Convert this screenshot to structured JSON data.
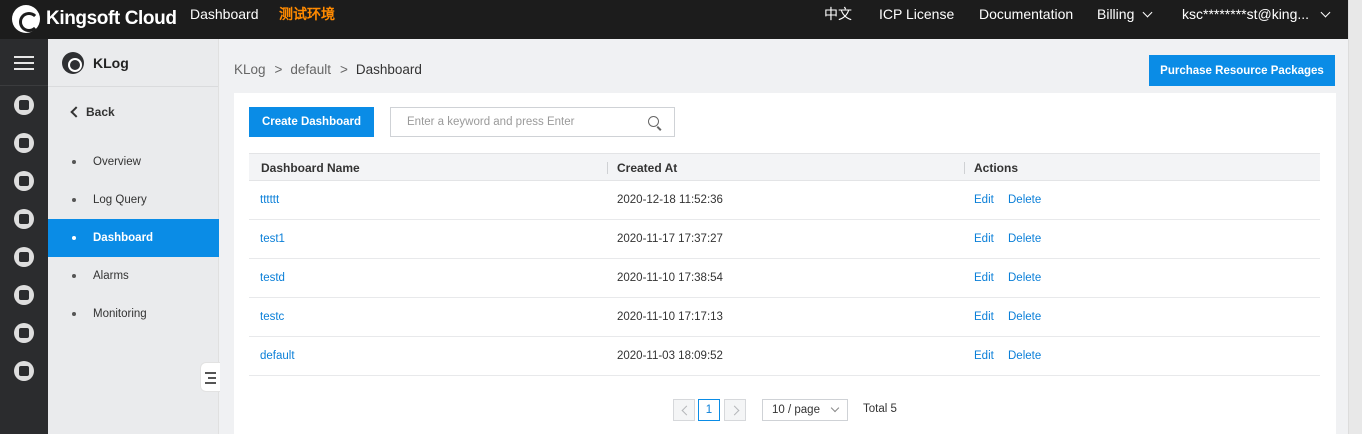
{
  "topbar": {
    "brand": "Kingsoft Cloud",
    "nav_dashboard": "Dashboard",
    "env_tag": "测试环境",
    "lang": "中文",
    "icp": "ICP License",
    "docs": "Documentation",
    "billing": "Billing",
    "account": "ksc********st@king..."
  },
  "sidebar": {
    "title": "KLog",
    "back": "Back",
    "items": [
      {
        "label": "Overview"
      },
      {
        "label": "Log Query"
      },
      {
        "label": "Dashboard"
      },
      {
        "label": "Alarms"
      },
      {
        "label": "Monitoring"
      }
    ],
    "active": "Dashboard"
  },
  "rail_icons": [
    "database-icon",
    "cloud-server-icon",
    "network-icon",
    "storage-icon",
    "group-icon",
    "monitor-wave-icon",
    "upload-cloud-icon",
    "list-card-icon"
  ],
  "breadcrumb": {
    "root": "KLog",
    "sep": ">",
    "mid": "default",
    "current": "Dashboard"
  },
  "purchase_button": "Purchase Resource Packages",
  "create_button": "Create Dashboard",
  "search": {
    "placeholder": "Enter a keyword and press Enter",
    "value": ""
  },
  "table": {
    "headers": {
      "name": "Dashboard Name",
      "created": "Created At",
      "actions": "Actions"
    },
    "rows": [
      {
        "name": "tttttt",
        "created": "2020-12-18 11:52:36",
        "edit": "Edit",
        "delete": "Delete"
      },
      {
        "name": "test1",
        "created": "2020-11-17 17:37:27",
        "edit": "Edit",
        "delete": "Delete"
      },
      {
        "name": "testd",
        "created": "2020-11-10 17:38:54",
        "edit": "Edit",
        "delete": "Delete"
      },
      {
        "name": "testc",
        "created": "2020-11-10 17:17:13",
        "edit": "Edit",
        "delete": "Delete"
      },
      {
        "name": "default",
        "created": "2020-11-03 18:09:52",
        "edit": "Edit",
        "delete": "Delete"
      }
    ]
  },
  "pagination": {
    "current_page": "1",
    "page_size": "10 / page",
    "total": "Total 5"
  },
  "colors": {
    "primary": "#0a8ce6",
    "topbar": "#1c1c1c",
    "rail": "#2b2c2e",
    "env_tag": "#ff8a00",
    "link": "#0a7fd8"
  }
}
